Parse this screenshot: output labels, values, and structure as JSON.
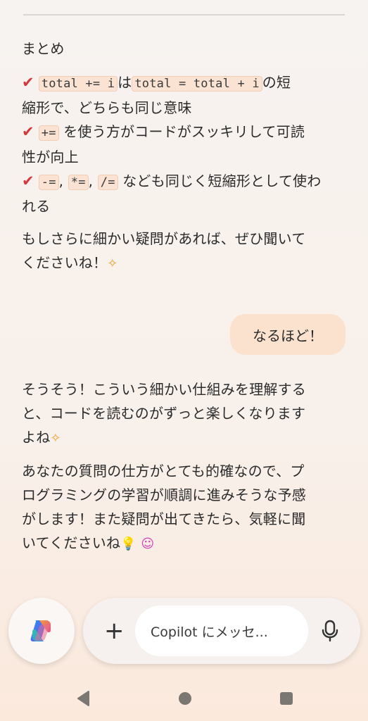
{
  "chat": {
    "heading": "まとめ",
    "bullets": [
      {
        "code1": "total += i",
        "text1": "は",
        "code2": "total = total + i",
        "text2": "の短",
        "line2": "縮形で、どちらも同じ意味"
      },
      {
        "code1": "+=",
        "text1": "を使う方がコードがスッキリして可読",
        "line2": "性が向上"
      },
      {
        "code1": "-=",
        "sep1": ",",
        "code2": "*=",
        "sep2": ",",
        "code3": "/=",
        "text1": "なども同じく短縮形として使わ",
        "line2": "れる"
      }
    ],
    "closing": [
      "もしさらに細かい疑問があれば、ぜひ聞いて",
      "くださいね！"
    ],
    "user_message": "なるほど！",
    "reply1": [
      "そうそう！こういう細かい仕組みを理解する",
      "と、コードを読むのがずっと楽しくなります",
      "よね"
    ],
    "reply2": [
      "あなたの質問の仕方がとても的確なので、プ",
      "ログラミングの学習が順調に進みそうな予感",
      "がします！また疑問が出てきたら、気軽に聞",
      "いてくださいね"
    ]
  },
  "composer": {
    "placeholder": "Copilot にメッセ..."
  },
  "icons": {
    "check": "✔",
    "sparkle": "✧",
    "bulb": "💡",
    "face": "ᵔᴥᵔ"
  }
}
